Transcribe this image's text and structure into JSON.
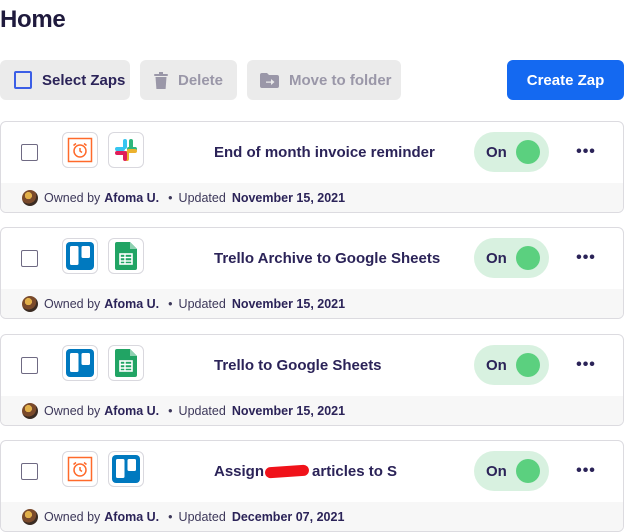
{
  "page": {
    "title": "Home"
  },
  "toolbar": {
    "select_label": "Select Zaps",
    "delete_label": "Delete",
    "move_label": "Move to folder",
    "create_label": "Create Zap"
  },
  "colors": {
    "accent": "#1469f1",
    "toggle_bg": "#d8f1e0",
    "toggle_knob": "#5bd07f"
  },
  "zaps": [
    {
      "title": "End of month invoice reminder",
      "icons": [
        "schedule-icon",
        "slack-icon"
      ],
      "status": "On",
      "owner_prefix": "Owned by",
      "owner": "Afoma U.",
      "updated_prefix": "Updated",
      "updated": "November 15, 2021"
    },
    {
      "title": "Trello Archive to Google Sheets",
      "icons": [
        "trello-icon",
        "google-sheets-icon"
      ],
      "status": "On",
      "owner_prefix": "Owned by",
      "owner": "Afoma U.",
      "updated_prefix": "Updated",
      "updated": "November 15, 2021"
    },
    {
      "title": "Trello to Google Sheets",
      "icons": [
        "trello-icon",
        "google-sheets-icon"
      ],
      "status": "On",
      "owner_prefix": "Owned by",
      "owner": "Afoma U.",
      "updated_prefix": "Updated",
      "updated": "November 15, 2021"
    },
    {
      "title_start": "Assign",
      "title_end": "articles to S",
      "icons": [
        "schedule-icon",
        "trello-icon"
      ],
      "status": "On",
      "owner_prefix": "Owned by",
      "owner": "Afoma U.",
      "updated_prefix": "Updated",
      "updated": "December 07, 2021"
    }
  ]
}
